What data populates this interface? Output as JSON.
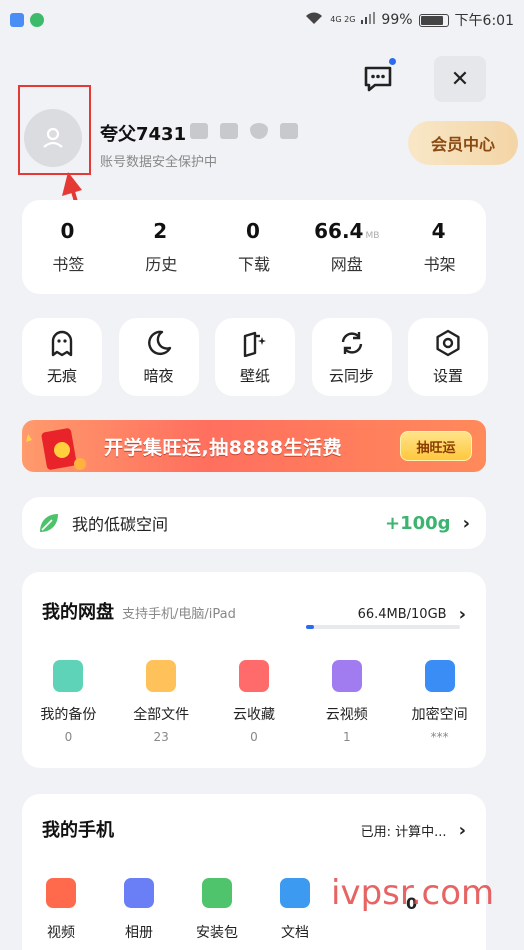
{
  "status_bar": {
    "battery": "99%",
    "time": "下午6:01",
    "network": "4G 2G"
  },
  "profile": {
    "username": "夸父7431",
    "subtitle": "账号数据安全保护中",
    "vip_button": "会员中心"
  },
  "stats": [
    {
      "value": "0",
      "unit": "",
      "label": "书签"
    },
    {
      "value": "2",
      "unit": "",
      "label": "历史"
    },
    {
      "value": "0",
      "unit": "",
      "label": "下载"
    },
    {
      "value": "66.4",
      "unit": "MB",
      "label": "网盘"
    },
    {
      "value": "4",
      "unit": "",
      "label": "书架"
    }
  ],
  "tools": [
    {
      "icon": "ghost-icon",
      "label": "无痕"
    },
    {
      "icon": "moon-icon",
      "label": "暗夜"
    },
    {
      "icon": "wallpaper-icon",
      "label": "壁纸"
    },
    {
      "icon": "sync-icon",
      "label": "云同步"
    },
    {
      "icon": "settings-icon",
      "label": "设置"
    }
  ],
  "banner": {
    "text": "开学集旺运,抽8888生活费",
    "button": "抽旺运"
  },
  "carbon": {
    "label": "我的低碳空间",
    "value": "+100g"
  },
  "cloud": {
    "title": "我的网盘",
    "subtitle": "支持手机/电脑/iPad",
    "usage": "66.4MB/10GB",
    "usage_fraction": 0.05,
    "items": [
      {
        "label": "我的备份",
        "count": "0",
        "color": "#5fd3b8"
      },
      {
        "label": "全部文件",
        "count": "23",
        "color": "#ffc25a"
      },
      {
        "label": "云收藏",
        "count": "0",
        "color": "#ff6b6b"
      },
      {
        "label": "云视频",
        "count": "1",
        "color": "#a07cf0"
      },
      {
        "label": "加密空间",
        "count": "***",
        "color": "#3a8df5"
      }
    ]
  },
  "phone": {
    "title": "我的手机",
    "usage": "已用: 计算中...",
    "items": [
      {
        "label": "视频",
        "color": "#ff6a4d"
      },
      {
        "label": "相册",
        "color": "#6a7ff5"
      },
      {
        "label": "安装包",
        "color": "#4fc46d"
      },
      {
        "label": "文档",
        "color": "#3c9bf0"
      }
    ],
    "extra_value": "0"
  },
  "watermark": "ivpsr.com"
}
